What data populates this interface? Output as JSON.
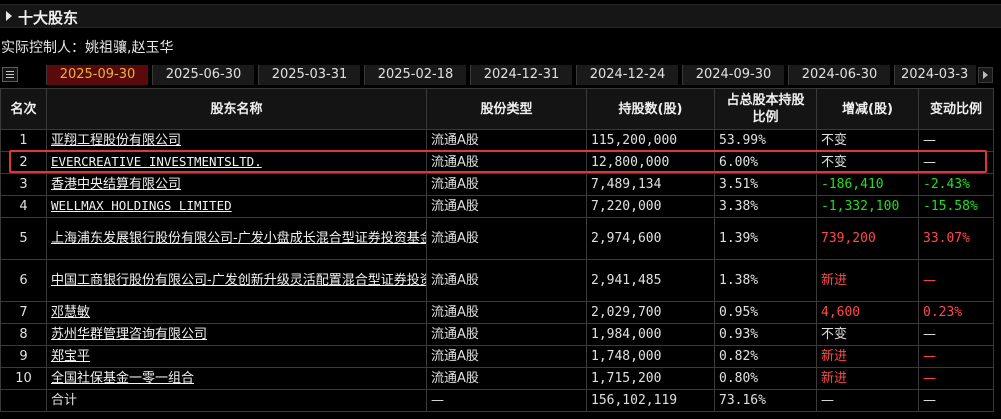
{
  "section": {
    "title": "十大股东"
  },
  "controller": {
    "label": "实际控制人：",
    "names": "姚祖骧,赵玉华"
  },
  "tabs": [
    {
      "label": "2025-09-30",
      "active": true
    },
    {
      "label": "2025-06-30"
    },
    {
      "label": "2025-03-31"
    },
    {
      "label": "2025-02-18"
    },
    {
      "label": "2024-12-31"
    },
    {
      "label": "2024-12-24"
    },
    {
      "label": "2024-09-30"
    },
    {
      "label": "2024-06-30"
    },
    {
      "label": "2024-03-3"
    }
  ],
  "table": {
    "headers": [
      "名次",
      "股东名称",
      "股份类型",
      "持股数(股)",
      "占总股本持股比例",
      "增减(股)",
      "变动比例"
    ],
    "rows": [
      {
        "rank": "1",
        "name": "亚翔工程股份有限公司",
        "type": "流通A股",
        "shares": "115,200,000",
        "ratio": "53.99%",
        "change": "不变",
        "change_ratio": "—",
        "change_color": "white"
      },
      {
        "rank": "2",
        "name": "EVERCREATIVE INVESTMENTSLTD.",
        "type": "流通A股",
        "shares": "12,800,000",
        "ratio": "6.00%",
        "change": "不变",
        "change_ratio": "—",
        "change_color": "white"
      },
      {
        "rank": "3",
        "name": "香港中央结算有限公司",
        "type": "流通A股",
        "shares": "7,489,134",
        "ratio": "3.51%",
        "change": "-186,410",
        "change_ratio": "-2.43%",
        "change_color": "green"
      },
      {
        "rank": "4",
        "name": "WELLMAX HOLDINGS LIMITED",
        "type": "流通A股",
        "shares": "7,220,000",
        "ratio": "3.38%",
        "change": "-1,332,100",
        "change_ratio": "-15.58%",
        "change_color": "green"
      },
      {
        "rank": "5",
        "name": "上海浦东发展银行股份有限公司-广发小盘成长混合型证券投资基金(LOF)",
        "type": "流通A股",
        "shares": "2,974,600",
        "ratio": "1.39%",
        "change": "739,200",
        "change_ratio": "33.07%",
        "change_color": "red"
      },
      {
        "rank": "6",
        "name": "中国工商银行股份有限公司-广发创新升级灵活配置混合型证券投资基金",
        "type": "流通A股",
        "shares": "2,941,485",
        "ratio": "1.38%",
        "change": "新进",
        "change_ratio": "—",
        "change_color": "red"
      },
      {
        "rank": "7",
        "name": "邓慧敏",
        "type": "流通A股",
        "shares": "2,029,700",
        "ratio": "0.95%",
        "change": "4,600",
        "change_ratio": "0.23%",
        "change_color": "red"
      },
      {
        "rank": "8",
        "name": "苏州华群管理咨询有限公司",
        "type": "流通A股",
        "shares": "1,984,000",
        "ratio": "0.93%",
        "change": "不变",
        "change_ratio": "—",
        "change_color": "white"
      },
      {
        "rank": "9",
        "name": "郑宝平",
        "type": "流通A股",
        "shares": "1,748,000",
        "ratio": "0.82%",
        "change": "新进",
        "change_ratio": "—",
        "change_color": "red"
      },
      {
        "rank": "10",
        "name": "全国社保基金一零一组合",
        "type": "流通A股",
        "shares": "1,715,200",
        "ratio": "0.80%",
        "change": "新进",
        "change_ratio": "—",
        "change_color": "red"
      }
    ],
    "total": {
      "label": "合计",
      "type": "—",
      "shares": "156,102,119",
      "ratio": "73.16%",
      "change": "—",
      "change_ratio": "—"
    }
  },
  "colors": {
    "active_tab_bg": "#5a0a0a",
    "active_tab_text": "#e8b436",
    "increase": "#ff4a4a",
    "decrease": "#1ee11e",
    "highlight_box": "#e0353a"
  },
  "icons": {
    "section_caret": "caret-right-icon",
    "menu": "menu-icon",
    "scroll": "chevron-right-icon"
  }
}
